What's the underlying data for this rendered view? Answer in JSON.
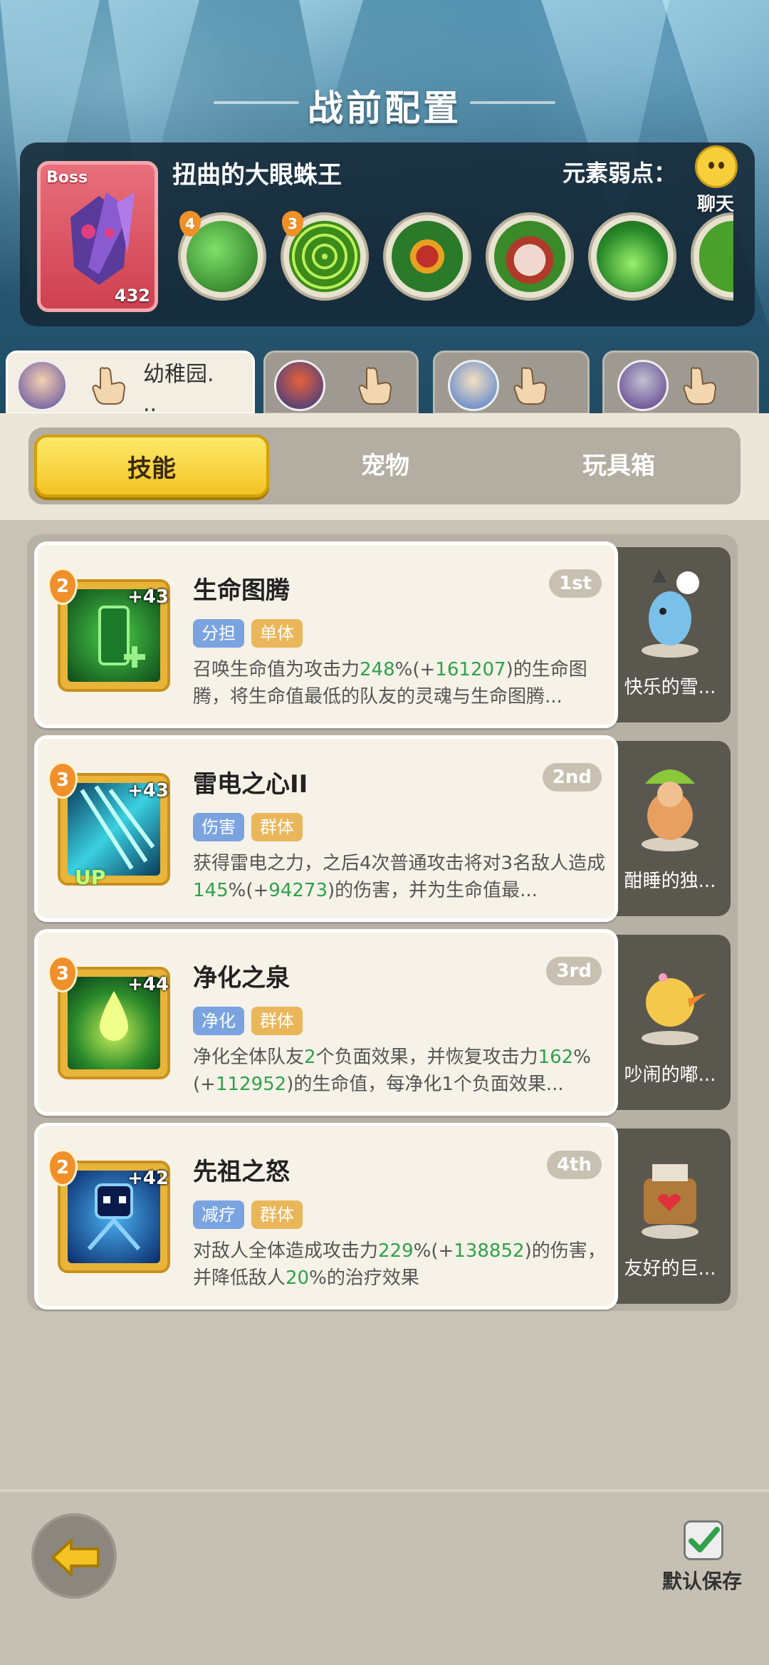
{
  "header": {
    "title": "战前配置"
  },
  "boss": {
    "tag": "Boss",
    "level": "432",
    "name": "扭曲的大眼蛛王",
    "weakness_label": "元素弱点：",
    "chat_label": "聊天",
    "skills": [
      {
        "icon": "green-slash-skill-icon",
        "badge": "4"
      },
      {
        "icon": "spider-web-skill-icon",
        "badge": "3"
      },
      {
        "icon": "spiked-plant-skill-icon",
        "badge": ""
      },
      {
        "icon": "boar-skill-icon",
        "badge": ""
      },
      {
        "icon": "green-slime-skill-icon",
        "badge": ""
      }
    ]
  },
  "team_tabs": [
    {
      "name": "幼稚园.\n..",
      "active": true
    },
    {
      "name": "",
      "active": false
    },
    {
      "name": "",
      "active": false
    },
    {
      "name": "",
      "active": false
    }
  ],
  "segment_tabs": [
    "技能",
    "宠物",
    "玩具箱"
  ],
  "skills": [
    {
      "level": "2",
      "plus": "+43",
      "name": "生命图腾",
      "rank": "1st",
      "tags": [
        "分担",
        "单体"
      ],
      "desc": "召唤生命值为攻击力248%(+161207)的生命图腾，将生命值最低的队友的灵魂与生命图腾...",
      "pet_name": "快乐的雪...",
      "up": ""
    },
    {
      "level": "3",
      "plus": "+43",
      "name": "雷电之心II",
      "rank": "2nd",
      "tags": [
        "伤害",
        "群体"
      ],
      "desc": "获得雷电之力，之后4次普通攻击将对3名敌人造成145%(+94273)的伤害，并为生命值最...",
      "pet_name": "酣睡的独...",
      "up": "UP"
    },
    {
      "level": "3",
      "plus": "+44",
      "name": "净化之泉",
      "rank": "3rd",
      "tags": [
        "净化",
        "群体"
      ],
      "desc": "净化全体队友2个负面效果，并恢复攻击力162%(+112952)的生命值，每净化1个负面效果...",
      "pet_name": "吵闹的嘟...",
      "up": ""
    },
    {
      "level": "2",
      "plus": "+42",
      "name": "先祖之怒",
      "rank": "4th",
      "tags": [
        "减疗",
        "群体"
      ],
      "desc": "对敌人全体造成攻击力229%(+138852)的伤害，并降低敌人20%的治疗效果",
      "pet_name": "友好的巨...",
      "up": ""
    }
  ],
  "bottom": {
    "save_label": "默认保存"
  },
  "colors": {
    "accent_yellow": "#f4c324",
    "highlight_green": "#2fa14b",
    "tag_blue": "#7aa3e0",
    "tag_orange": "#eab65a"
  }
}
